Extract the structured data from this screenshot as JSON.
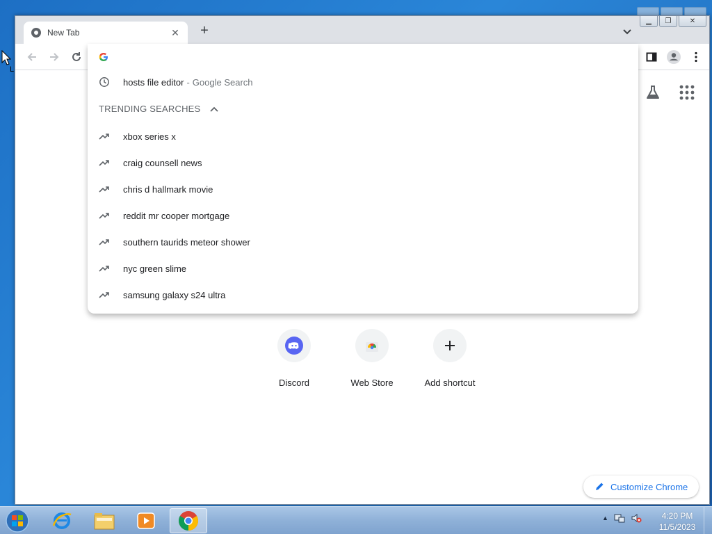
{
  "desktop": {
    "left_icon_letter": "L"
  },
  "tab": {
    "title": "New Tab"
  },
  "omnibox": {
    "history_item": {
      "query": "hosts file editor",
      "separator": "-",
      "suffix": "Google Search"
    },
    "trending_header": "TRENDING SEARCHES",
    "trending": [
      "xbox series x",
      "craig counsell news",
      "chris d hallmark movie",
      "reddit mr cooper mortgage",
      "southern taurids meteor shower",
      "nyc green slime",
      "samsung galaxy s24 ultra"
    ]
  },
  "shortcuts": [
    {
      "label": "Discord",
      "icon": "discord-icon"
    },
    {
      "label": "Web Store",
      "icon": "webstore-icon"
    },
    {
      "label": "Add shortcut",
      "icon": "plus-icon"
    }
  ],
  "customize": {
    "label": "Customize Chrome"
  },
  "taskbar": {
    "clock_time": "4:20 PM",
    "clock_date": "11/5/2023"
  },
  "colors": {
    "accent": "#1a73e8",
    "discord": "#5865f2"
  }
}
